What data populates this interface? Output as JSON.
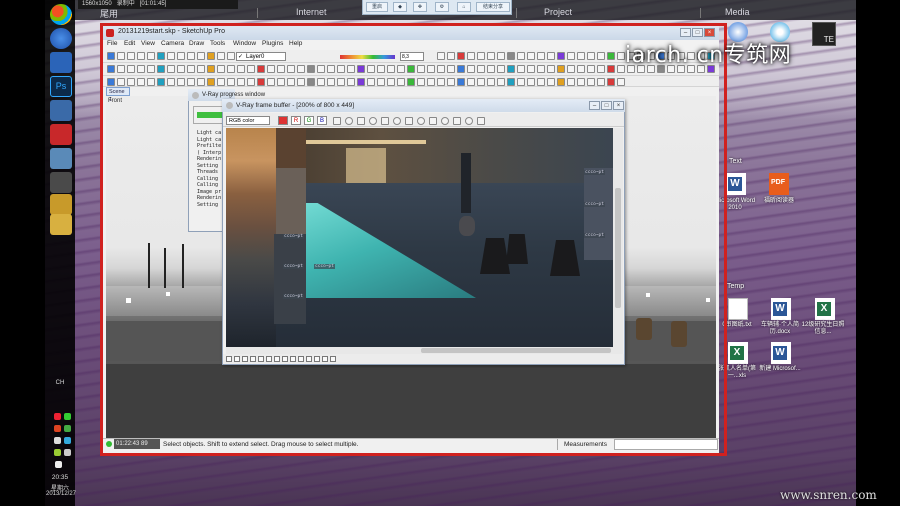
{
  "overlay_toolbar": {
    "resolution": "1560x1050",
    "recording": "录制中",
    "timer": "[01:01:45]"
  },
  "desktop_top_labels": [
    "尾用",
    "Internet",
    "Project",
    "Media"
  ],
  "float_toolbar": {
    "btn1": "重启",
    "btn2": "结束分享"
  },
  "taskbar": {
    "tray_label": "CH",
    "time": "20:35",
    "weekday": "星期六",
    "date": "2013/12/27"
  },
  "sketchup": {
    "title": "20131219start.skp - SketchUp Pro",
    "menus": [
      "File",
      "Edit",
      "View",
      "Camera",
      "Draw",
      "Tools",
      "Window",
      "Plugins",
      "Help"
    ],
    "layer": "Layer0",
    "scene_tab": "Scene 1",
    "view_label": "Front",
    "toolbar_field": "8,3",
    "status_text": "Select objects. Shift to extend select. Drag mouse to select multiple.",
    "status_timer": "01:22:43",
    "status_count": "89",
    "measurements": "Measurements"
  },
  "vray_progress": {
    "title": "V-Ray progress window",
    "log": [
      "Light ca",
      "Light ca",
      "Prefilte",
      "( Interp",
      "Renderin",
      "Setting",
      "Threads",
      "Calling",
      "Calling",
      "Image pr",
      "Renderin",
      "Setting"
    ]
  },
  "vray_fb": {
    "title": "V-Ray frame buffer - [200% of 800 x 449]",
    "channel": "RGB color",
    "r": "R",
    "g": "G",
    "b": "B",
    "tags": [
      "ccco~pt",
      "ccco~pt",
      "ccco~pt",
      "ccco~pt",
      "ccco~pt",
      "ccco~pt",
      "ccco~pt"
    ]
  },
  "desktop_section": {
    "text_label": "Text",
    "temp_label": "Temp"
  },
  "desktop_icons": [
    {
      "label": "Microsoft Word 2010",
      "color": "#2b5797"
    },
    {
      "label": "福昕阅读器",
      "color": "#e85d1c"
    },
    {
      "label": "0审图纸.txt",
      "color": "#ffffff"
    },
    {
      "label": "车辆辅·个人简历.docx",
      "color": "#2b5797"
    },
    {
      "label": "12级研究生日照信息...",
      "color": "#217346"
    },
    {
      "label": "张凯人名单(第一...xls",
      "color": "#217346"
    },
    {
      "label": "新建 Microsof...",
      "color": "#2b5797"
    }
  ],
  "top_right_apps": [
    "TE"
  ],
  "watermark_main": "iarch. cn专筑网",
  "watermark_footer": "www.snren.com"
}
